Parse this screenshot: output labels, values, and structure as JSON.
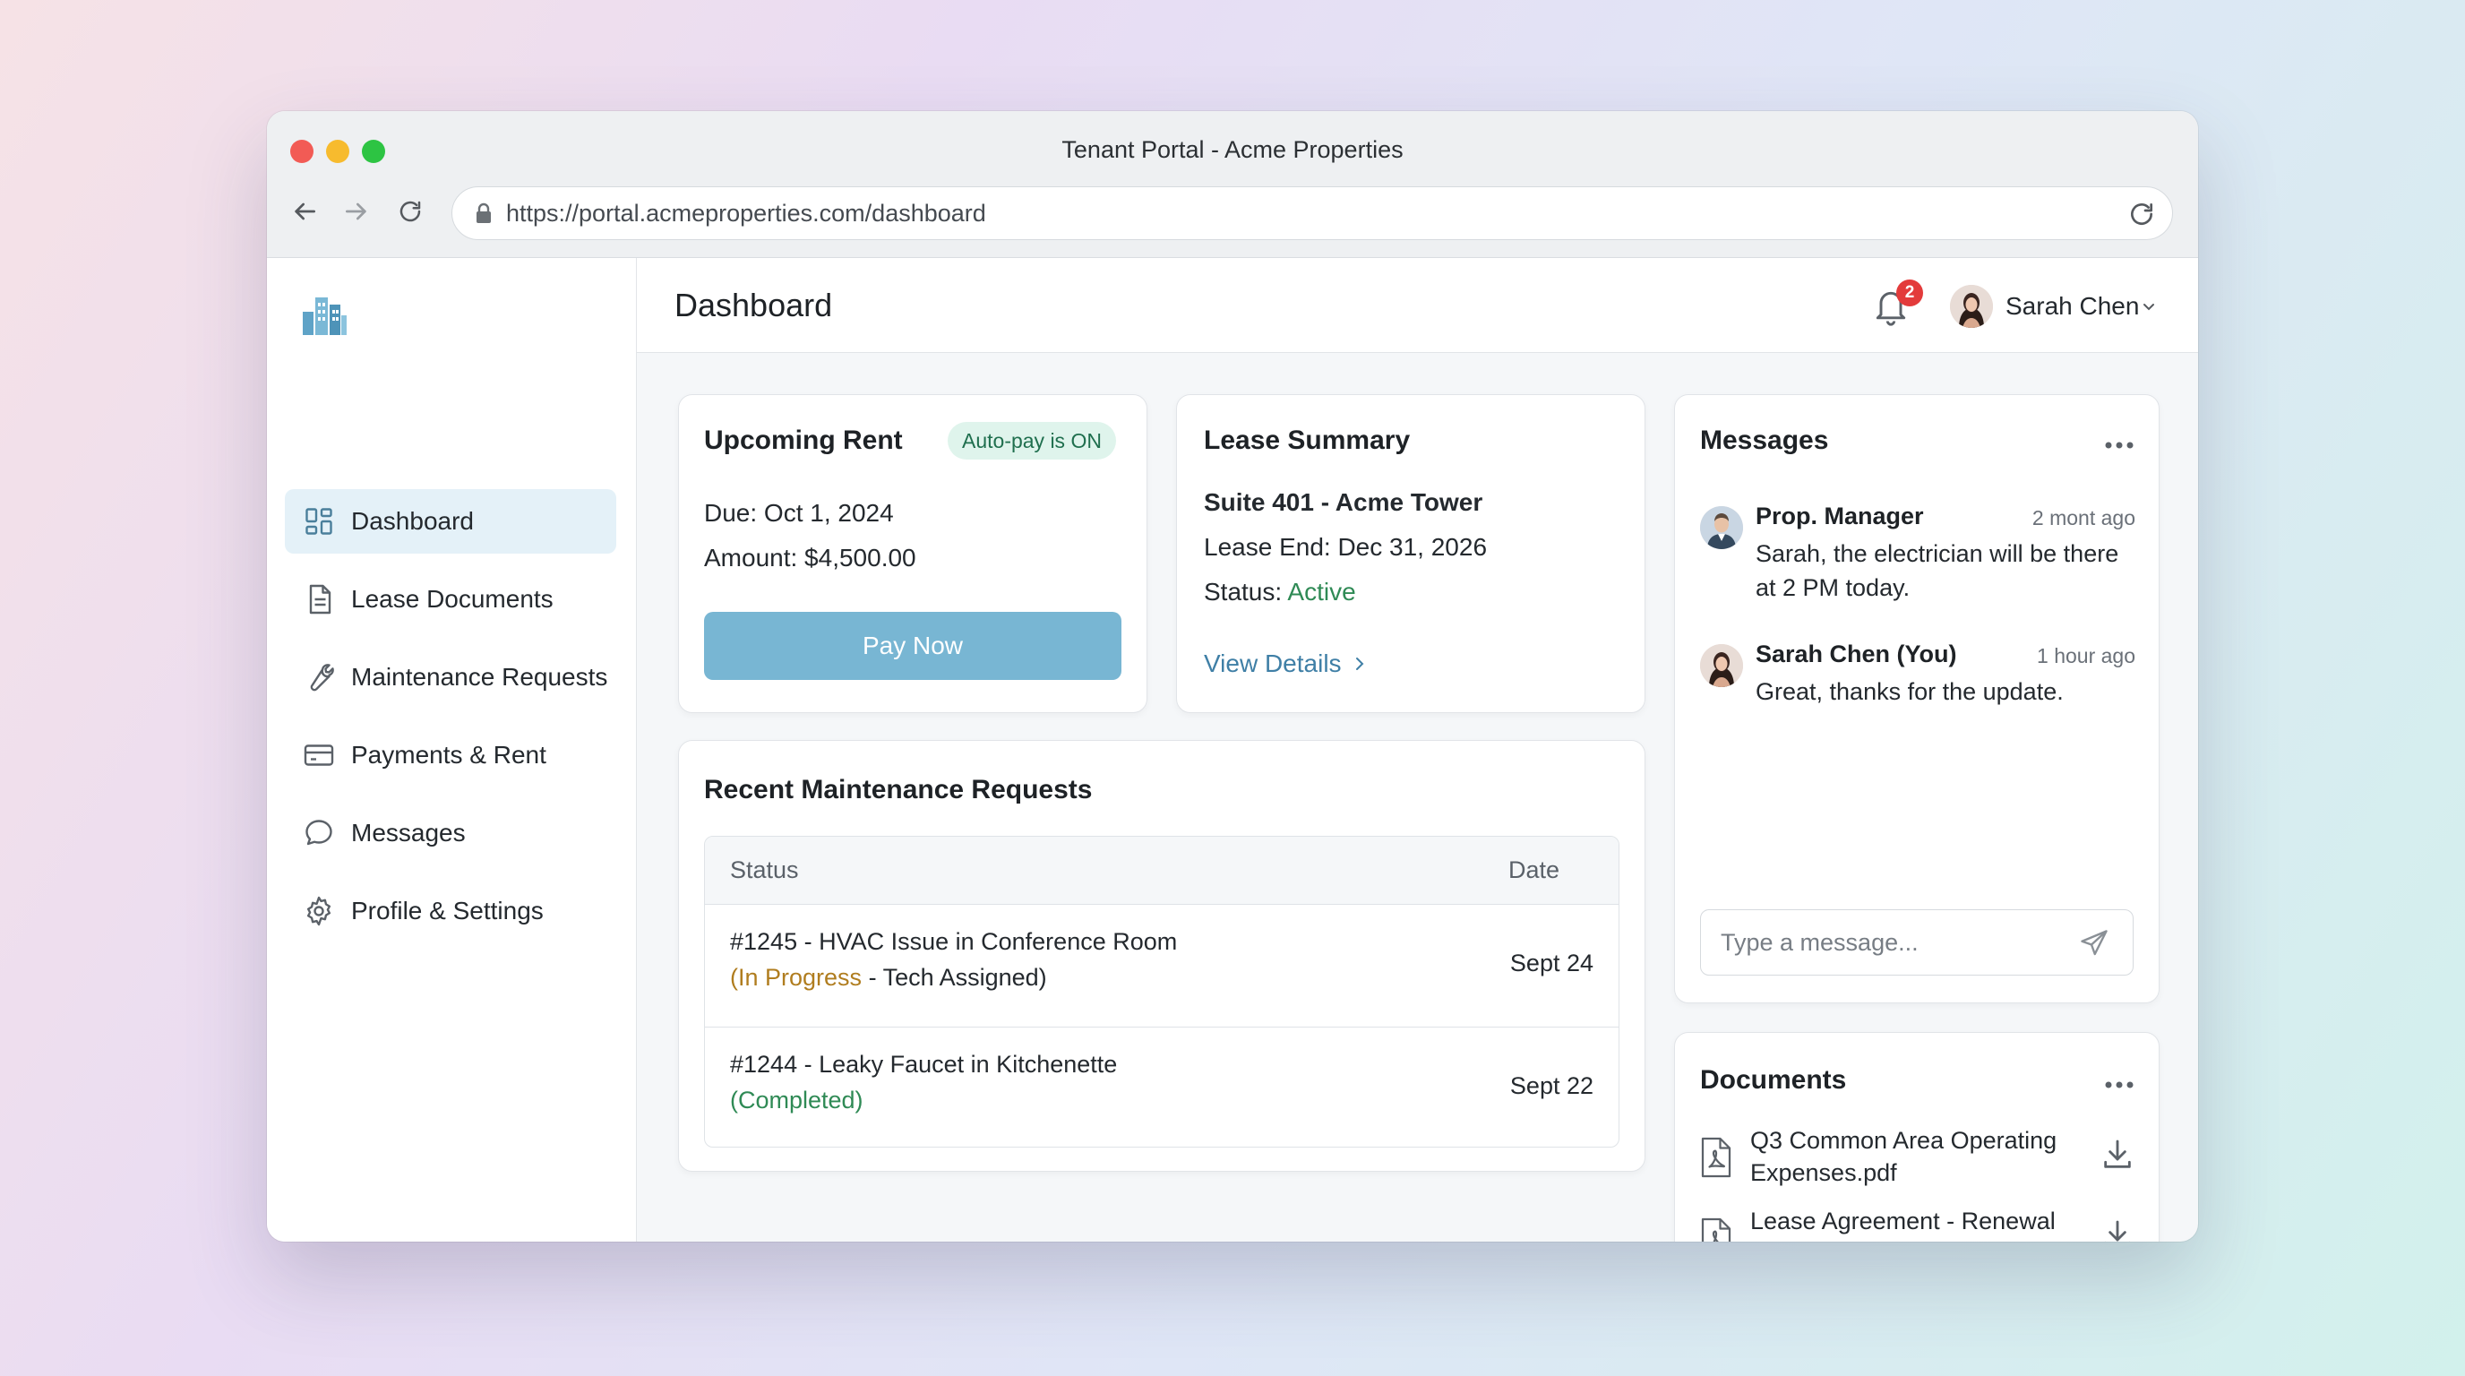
{
  "window": {
    "title": "Tenant Portal - Acme Properties",
    "url": "https://portal.acmeproperties.com/dashboard"
  },
  "sidebar": {
    "logo_icon": "building-icon",
    "items": [
      {
        "label": "Dashboard",
        "icon": "grid-icon",
        "active": true
      },
      {
        "label": "Lease Documents",
        "icon": "document-icon",
        "active": false
      },
      {
        "label": "Maintenance Requests",
        "icon": "wrench-icon",
        "active": false
      },
      {
        "label": "Payments & Rent",
        "icon": "credit-card-icon",
        "active": false
      },
      {
        "label": "Messages",
        "icon": "chat-bubble-icon",
        "active": false
      },
      {
        "label": "Profile & Settings",
        "icon": "gear-icon",
        "active": false
      }
    ]
  },
  "header": {
    "title": "Dashboard",
    "notification_count": "2",
    "user_name": "Sarah Chen"
  },
  "rent": {
    "title": "Upcoming Rent",
    "badge": "Auto-pay is ON",
    "due": "Due: Oct 1, 2024",
    "amount": "Amount: $4,500.00",
    "pay_label": "Pay Now"
  },
  "lease": {
    "title": "Lease Summary",
    "suite": "Suite 401 - Acme Tower",
    "end": "Lease End: Dec 31, 2026",
    "status_prefix": "Status: ",
    "status": "Active",
    "view_details": "View Details"
  },
  "maintenance": {
    "title": "Recent Maintenance Requests",
    "columns": {
      "status": "Status",
      "date": "Date"
    },
    "rows": [
      {
        "title": "#1245 - HVAC Issue in Conference Room",
        "status": "(In Progress",
        "detail": " - Tech Assigned)",
        "date": "Sept 24"
      },
      {
        "title": "#1244 - Leaky Faucet in Kitchenette",
        "status": "(Completed)",
        "detail": "",
        "date": "Sept 22"
      }
    ]
  },
  "messages": {
    "title": "Messages",
    "items": [
      {
        "sender": "Prop. Manager",
        "time": "2 mont ago",
        "body": "Sarah, the electrician will be there at 2 PM today."
      },
      {
        "sender": "Sarah Chen (You)",
        "time": "1 hour ago",
        "body": "Great, thanks for the update."
      }
    ],
    "input_placeholder": "Type a message..."
  },
  "documents": {
    "title": "Documents",
    "items": [
      {
        "name": "Q3 Common Area Operating Expenses.pdf"
      },
      {
        "name": "Lease Agreement - Renewal Draft.pdf"
      }
    ]
  },
  "colors": {
    "accent": "#78b6d3",
    "active_nav": "#e4f1f8",
    "status_green": "#2f8a55",
    "status_amber": "#b07d1f",
    "badge_red": "#e33b3b"
  }
}
